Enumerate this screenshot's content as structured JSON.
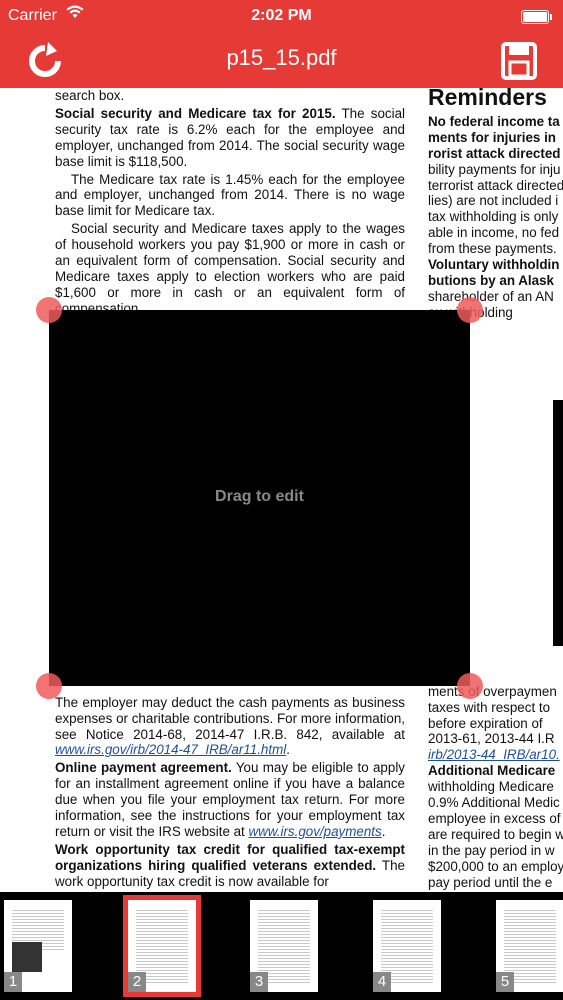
{
  "status_bar": {
    "carrier": "Carrier",
    "time": "2:02 PM"
  },
  "nav": {
    "title": "p15_15.pdf"
  },
  "document": {
    "left_paragraphs": [
      {
        "text": "search box."
      },
      {
        "heading": "Social security and Medicare tax for 2015.",
        "text": " The social security tax rate is 6.2% each for the employee and employer, unchanged from 2014. The social security wage base limit is $118,500."
      },
      {
        "text": "The Medicare tax rate is 1.45% each for the employee and employer, unchanged from 2014. There is no wage base limit for Medicare tax.",
        "indent": true
      },
      {
        "text": "Social security and Medicare taxes apply to the wages of household workers you pay $1,900 or more in cash or an equivalent form of compensation. Social security and Medicare taxes apply to election workers who are paid $1,600 or more in cash or an equivalent form of compensation.",
        "indent": true
      }
    ],
    "left_after": [
      {
        "text": "The employer may deduct the cash payments as business expenses or charitable contributions. For more information, see Notice 2014-68, 2014-47 I.R.B. 842, available at ",
        "link": "www.irs.gov/irb/2014-47_IRB/ar11.html",
        "tail": "."
      },
      {
        "heading": "Online payment agreement.",
        "text": " You may be eligible to apply for an installment agreement online if you have a balance due when you file your employment tax return. For more information, see the instructions for your employment tax return or visit the IRS website at ",
        "link": "www.irs.gov/payments",
        "tail": "."
      },
      {
        "heading": "Work opportunity tax credit for qualified tax-exempt organizations hiring qualified veterans extended.",
        "text": " The work opportunity tax credit is now available for"
      }
    ],
    "right_heading": "Reminders",
    "right_lines_top": [
      "No federal income ta",
      "ments for injuries in",
      "rorist attack directed",
      "bility payments for inju",
      "terrorist attack directed",
      "lies) are not included i",
      "tax withholding is only",
      "able in income, no fed",
      "from these payments.",
      "Voluntary withholdin",
      "butions by an Alask",
      "shareholder of an AN",
      "ax withholding"
    ],
    "right_lines_bottom": [
      "ments of overpaymen",
      "taxes with respect to",
      "before expiration of",
      "2013-61, 2013-44 I.R",
      "irb/2013-44_IRB/ar10.",
      "Additional Medicare",
      "withholding Medicare",
      "0.9% Additional Medic",
      "employee in excess of",
      "are required to begin w",
      "in the pay period in w",
      "$200,000 to an employ",
      "pay period until the e"
    ]
  },
  "crop_overlay": {
    "hint": "Drag to edit"
  },
  "thumbnails": [
    {
      "number": "1",
      "selected": false
    },
    {
      "number": "2",
      "selected": true
    },
    {
      "number": "3",
      "selected": false
    },
    {
      "number": "4",
      "selected": false
    },
    {
      "number": "5",
      "selected": false
    }
  ],
  "colors": {
    "accent": "#e53a35",
    "handle": "#ef5a5a",
    "link": "#1f4e9e"
  },
  "icons": {
    "refresh": "refresh-icon",
    "save": "save-icon",
    "wifi": "wifi-icon",
    "battery": "battery-icon"
  }
}
